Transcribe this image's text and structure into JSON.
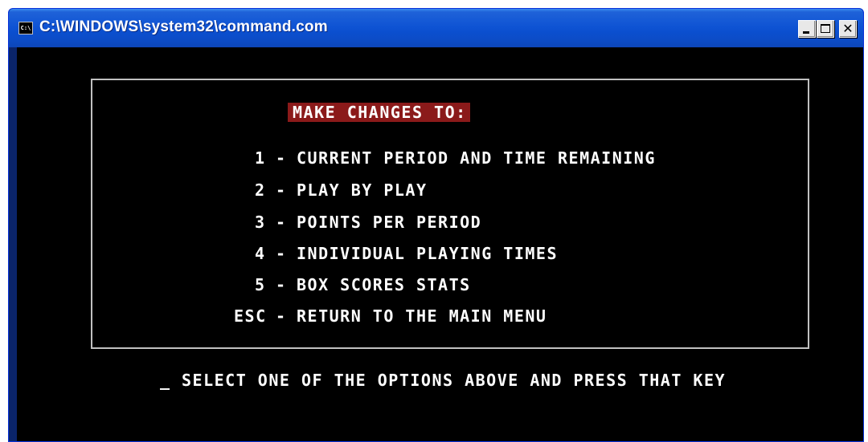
{
  "window": {
    "title": "C:\\WINDOWS\\system32\\command.com",
    "icon": "console-icon",
    "controls": [
      "minimize",
      "maximize",
      "close"
    ]
  },
  "menu": {
    "heading": "MAKE CHANGES TO:",
    "heading_bg": "#8b1a1a",
    "items": [
      {
        "key": "1",
        "label": "CURRENT PERIOD AND TIME REMAINING"
      },
      {
        "key": "2",
        "label": "PLAY BY PLAY"
      },
      {
        "key": "3",
        "label": "POINTS PER PERIOD"
      },
      {
        "key": "4",
        "label": "INDIVIDUAL PLAYING TIMES"
      },
      {
        "key": "5",
        "label": "BOX SCORES STATS"
      },
      {
        "key": "ESC",
        "label": "RETURN TO THE MAIN MENU"
      }
    ],
    "separator": "-"
  },
  "prompt": {
    "cursor": "_",
    "text": "SELECT ONE OF THE OPTIONS ABOVE AND PRESS THAT KEY"
  }
}
